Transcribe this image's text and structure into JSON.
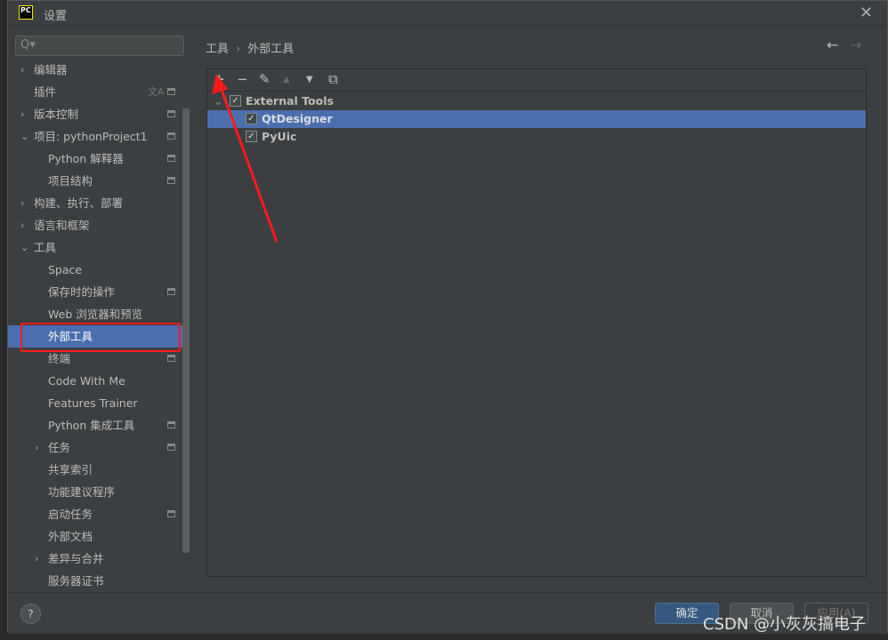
{
  "window": {
    "title": "设置",
    "logo": "PC"
  },
  "search": {
    "placeholder": "Q▾"
  },
  "sidebar": {
    "items": [
      {
        "label": "编辑器",
        "arrow": "›"
      },
      {
        "label": "插件"
      },
      {
        "label": "版本控制",
        "arrow": "›"
      },
      {
        "label": "项目: pythonProject1",
        "arrow": "⌄"
      },
      {
        "label": "Python 解释器"
      },
      {
        "label": "项目结构"
      },
      {
        "label": "构建、执行、部署",
        "arrow": "›"
      },
      {
        "label": "语言和框架",
        "arrow": "›"
      },
      {
        "label": "工具",
        "arrow": "⌄"
      },
      {
        "label": "Space"
      },
      {
        "label": "保存时的操作"
      },
      {
        "label": "Web 浏览器和预览"
      },
      {
        "label": "外部工具"
      },
      {
        "label": "终端"
      },
      {
        "label": "Code With Me"
      },
      {
        "label": "Features Trainer"
      },
      {
        "label": "Python 集成工具"
      },
      {
        "label": "任务",
        "arrow": "›"
      },
      {
        "label": "共享索引"
      },
      {
        "label": "功能建议程序"
      },
      {
        "label": "启动任务"
      },
      {
        "label": "外部文档"
      },
      {
        "label": "差异与合并",
        "arrow": "›"
      },
      {
        "label": "服务器证书"
      }
    ]
  },
  "breadcrumb": {
    "parent": "工具",
    "sep": "›",
    "current": "外部工具"
  },
  "nav": {
    "back": "←",
    "forward": "→"
  },
  "toolbar": {
    "add": "+",
    "remove": "−",
    "edit": "✎",
    "up": "▲",
    "down": "▼",
    "copy": "⧉"
  },
  "tree": {
    "group": "External Tools",
    "items": [
      "QtDesigner",
      "PyUic"
    ],
    "check": "✓",
    "expand": "⌄"
  },
  "footer": {
    "help": "?",
    "ok": "确定",
    "cancel": "取消",
    "apply": "应用(A)"
  },
  "watermark": "CSDN @小灰灰搞电子",
  "colors": {
    "selection": "#4b6eaf",
    "annotation": "#ff1a1a"
  }
}
